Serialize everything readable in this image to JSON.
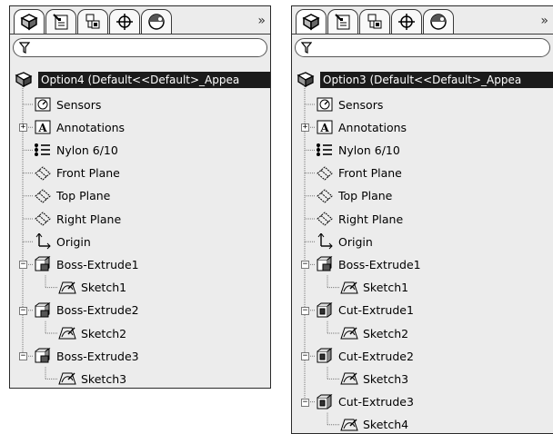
{
  "panels": [
    {
      "root_label": "Option4  (Default<<Default>_Appea",
      "tabs": [
        "feature-manager-icon",
        "property-manager-icon",
        "configuration-manager-icon",
        "dimxpert-icon",
        "display-manager-icon"
      ],
      "more_label": "»",
      "items": [
        {
          "label": "Sensors"
        },
        {
          "label": "Annotations"
        },
        {
          "label": "Nylon 6/10"
        },
        {
          "label": "Front Plane"
        },
        {
          "label": "Top Plane"
        },
        {
          "label": "Right Plane"
        },
        {
          "label": "Origin"
        },
        {
          "label": "Boss-Extrude1"
        },
        {
          "label": "Sketch1"
        },
        {
          "label": "Boss-Extrude2"
        },
        {
          "label": "Sketch2"
        },
        {
          "label": "Boss-Extrude3"
        },
        {
          "label": "Sketch3"
        }
      ]
    },
    {
      "root_label": "Option3  (Default<<Default>_Appea",
      "tabs": [
        "feature-manager-icon",
        "property-manager-icon",
        "configuration-manager-icon",
        "dimxpert-icon",
        "display-manager-icon"
      ],
      "more_label": "»",
      "items": [
        {
          "label": "Sensors"
        },
        {
          "label": "Annotations"
        },
        {
          "label": "Nylon 6/10"
        },
        {
          "label": "Front Plane"
        },
        {
          "label": "Top Plane"
        },
        {
          "label": "Right Plane"
        },
        {
          "label": "Origin"
        },
        {
          "label": "Boss-Extrude1"
        },
        {
          "label": "Sketch1"
        },
        {
          "label": "Cut-Extrude1"
        },
        {
          "label": "Sketch2"
        },
        {
          "label": "Cut-Extrude2"
        },
        {
          "label": "Sketch3"
        },
        {
          "label": "Cut-Extrude3"
        },
        {
          "label": "Sketch4"
        }
      ]
    }
  ]
}
